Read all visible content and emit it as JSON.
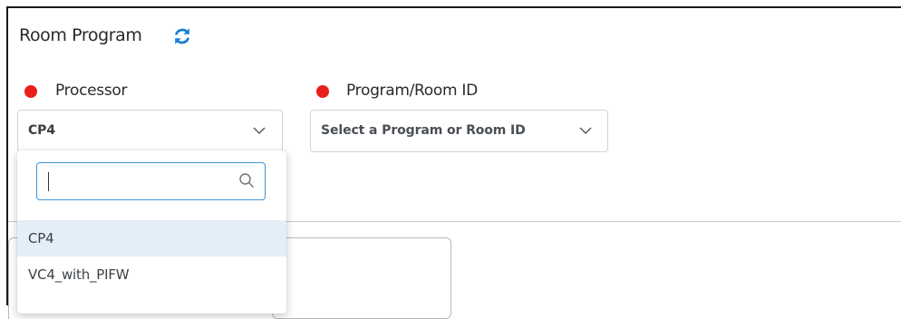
{
  "section": {
    "title": "Room Program"
  },
  "processor": {
    "label": "Processor",
    "selected_value": "CP4",
    "search_value": "",
    "options": [
      "CP4",
      "VC4_with_PIFW"
    ],
    "selected_index": 0
  },
  "program": {
    "label": "Program/Room ID",
    "placeholder": "Select a Program or Room ID"
  },
  "colors": {
    "required_dot": "#e8201a",
    "accent": "#1a7fd6",
    "selected_option_bg": "#e3eef8",
    "focus_border": "#3b95d6"
  },
  "icons": {
    "refresh": "refresh-icon",
    "chevron": "chevron-down-icon",
    "search": "search-icon"
  }
}
